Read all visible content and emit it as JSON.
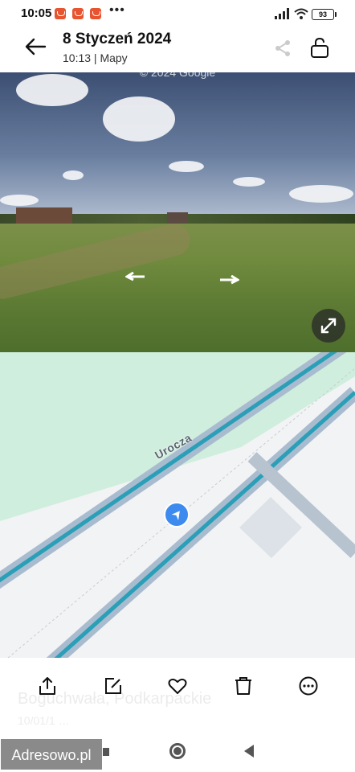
{
  "status_bar": {
    "time": "10:05",
    "dots": "•••",
    "battery": "93"
  },
  "app_bar": {
    "title": "8 Styczeń 2024",
    "subtitle": "10:13 | Mapy",
    "icons": [
      "arrow-left-icon",
      "share-icon",
      "lock-icon"
    ]
  },
  "photo": {
    "watermark_top": "Google",
    "copyright": "© 2024 Google"
  },
  "map": {
    "street_name": "Urocza"
  },
  "action_bar": {
    "faded_place": "Boguchwała, Podkarpackie",
    "faded_date": "10/01/1 …",
    "icons": [
      "upload-icon",
      "edit-icon",
      "heart-icon",
      "trash-icon",
      "more-icon"
    ]
  },
  "navbar": {
    "watermark": "Adresowo.pl"
  },
  "colors": {
    "location_pin": "#3d8bef",
    "road_outline": "#a9bccf",
    "road_center": "#2b9fb7",
    "park": "#cfeedd",
    "notification": "#e8542f"
  }
}
